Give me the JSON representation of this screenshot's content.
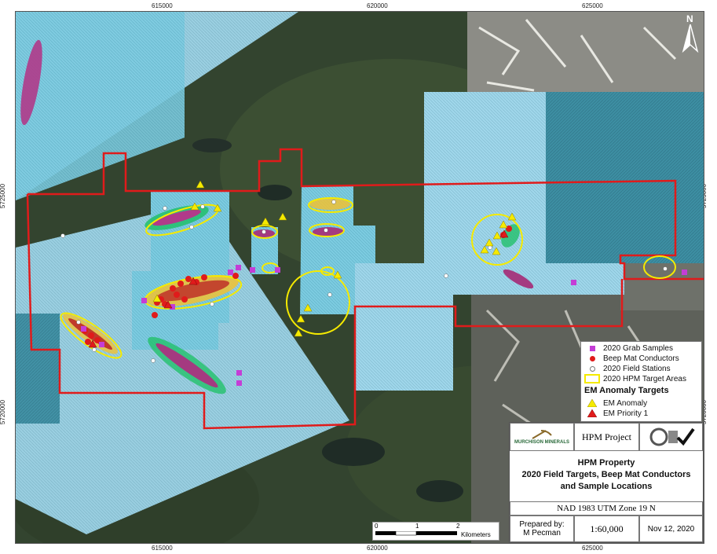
{
  "grid": {
    "x_labels": [
      "615000",
      "620000",
      "625000"
    ],
    "y_labels": [
      "5725000",
      "5720000"
    ]
  },
  "north_label": "N",
  "legend": {
    "items": [
      {
        "label": "2020 Grab Samples",
        "symbol": "square",
        "color": "#c43dd6"
      },
      {
        "label": "Beep Mat Conductors",
        "symbol": "circle",
        "color": "#e01b1b"
      },
      {
        "label": "2020 Field Stations",
        "symbol": "small-circle",
        "color": "#ffffff"
      },
      {
        "label": "2020 HPM Target Areas",
        "symbol": "rect-outline",
        "color": "#f5ea00"
      }
    ],
    "em_header": "EM Anomaly Targets",
    "em_items": [
      {
        "label": "EM Anomaly",
        "symbol": "triangle",
        "color": "#f5ea00"
      },
      {
        "label": "EM Priority 1",
        "symbol": "triangle",
        "color": "#e01b1b"
      }
    ]
  },
  "title_block": {
    "company": "MURCHISON MINERALS",
    "project": "HPM Project",
    "title_line1": "HPM Property",
    "title_line2": "2020 Field Targets, Beep Mat Conductors",
    "title_line3": "and Sample Locations",
    "projection": "NAD 1983 UTM Zone 19 N",
    "prepared_label": "Prepared by:",
    "prepared_name": "M Pecman",
    "scale": "1:60,000",
    "date": "Nov 12, 2020"
  },
  "scale_bar": {
    "ticks": [
      "0",
      "1",
      "2"
    ],
    "unit": "Kilometers"
  },
  "colors": {
    "property_boundary": "#e01b1b",
    "target_areas": "#f5ea00",
    "em_tiles": "#8fd0e6"
  }
}
